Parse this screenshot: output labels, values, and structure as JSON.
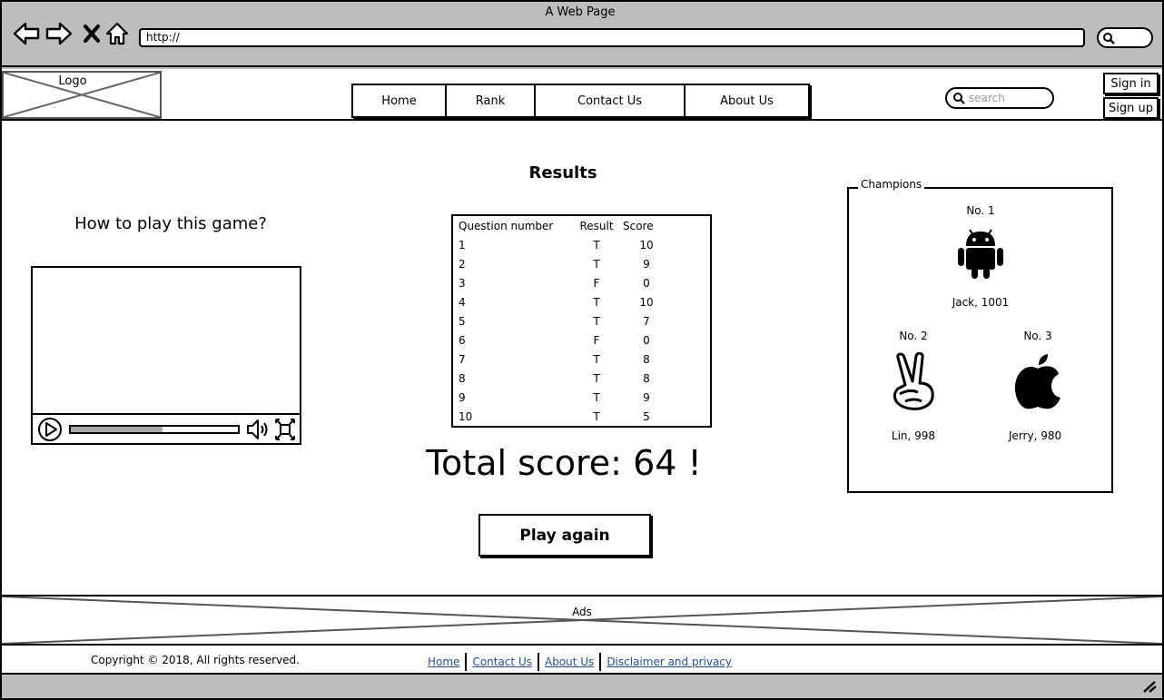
{
  "window": {
    "title": "A Web Page",
    "url": "http://"
  },
  "header": {
    "logo_label": "Logo",
    "nav": [
      "Home",
      "Rank",
      "Contact Us",
      "About Us"
    ],
    "search_placeholder": "search",
    "sign_in": "Sign in",
    "sign_up": "Sign up"
  },
  "main": {
    "howto_title": "How to play this game?",
    "video": {
      "progress": 0.55
    },
    "results_title": "Results",
    "table": {
      "headers": [
        "Question number",
        "Result",
        "Score"
      ],
      "rows": [
        [
          "1",
          "T",
          "10"
        ],
        [
          "2",
          "T",
          "9"
        ],
        [
          "3",
          "F",
          "0"
        ],
        [
          "4",
          "T",
          "10"
        ],
        [
          "5",
          "T",
          "7"
        ],
        [
          "6",
          "F",
          "0"
        ],
        [
          "7",
          "T",
          "8"
        ],
        [
          "8",
          "T",
          "8"
        ],
        [
          "9",
          "T",
          "9"
        ],
        [
          "10",
          "T",
          "5"
        ]
      ]
    },
    "total_label": "Total score:  64 !",
    "play_again": "Play again",
    "champions": {
      "legend": "Champions",
      "first": {
        "rank": "No. 1",
        "name": "Jack,  1001",
        "icon": "android-icon"
      },
      "second": {
        "rank": "No. 2",
        "name": "Lin,  998",
        "icon": "peace-hand-icon"
      },
      "third": {
        "rank": "No. 3",
        "name": "Jerry, 980",
        "icon": "apple-icon"
      }
    }
  },
  "ads": {
    "label": "Ads"
  },
  "footer": {
    "copyright": "Copyright  ©   2018, All rights reserved.",
    "links": [
      "Home",
      "Contact Us",
      "About Us",
      "Disclaimer and privacy"
    ]
  }
}
